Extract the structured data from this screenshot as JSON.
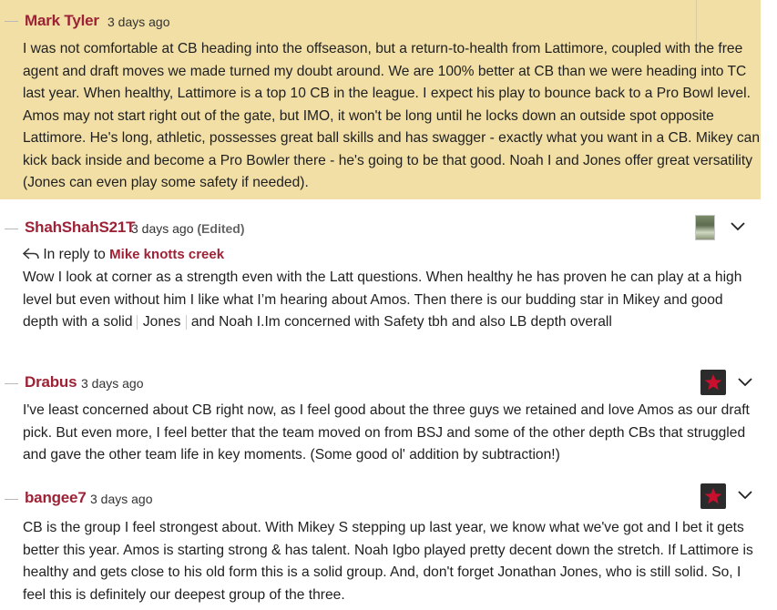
{
  "comments": [
    {
      "author": "Mark Tyler",
      "time": "3 days ago",
      "body": "I was not comfortable at CB heading into the offseason, but a return-to-health from Lattimore, coupled with the free agent and draft moves we made turned my doubt around. We are 100% better at CB than we were heading into TC last year. When healthy, Lattimore is a top 10 CB in the league. I expect his play to bounce back to a Pro Bowl level. Amos may not start right out of the gate, but IMO, it won't be long until he locks down an outside spot opposite Lattimore. He's long, athletic, possesses great ball skills and has swagger - exactly what you want in a CB. Mikey can kick back inside and become a Pro Bowler there - he's going to be that good. Noah I and Jones offer great versatility (Jones can even play some safety if needed)."
    },
    {
      "author": "ShahShahS21T",
      "time": "3 days ago",
      "edited": "(Edited)",
      "reply_prefix": "In reply to",
      "reply_to": "Mike knotts creek",
      "body_before": "Wow I look at corner as a strength even with the Latt questions. When healthy he has proven he can play at a high level but even without him I like what I’m hearing about Amos. Then there is our budding star in Mikey and good depth with a solid",
      "body_mention": "Jones",
      "body_after": "and Noah I.Im concerned with Safety tbh and also LB depth overall"
    },
    {
      "author": "Drabus",
      "time": "3 days ago",
      "body": "I've least concerned about CB right now, as I feel good about the three guys we retained and love Amos as our draft pick. But even more, I feel better that the team moved on from BSJ and some of the other depth CBs that struggled and gave the other team life in key moments. (Some good ol' addition by subtraction!)"
    },
    {
      "author": "bangee7",
      "time": "3 days ago",
      "body": "CB is the group I feel strongest about. With Mikey S stepping up last year, we know what we've got and I bet it gets better this year. Amos is starting strong & has talent. Noah Igbo played pretty decent down the stretch. If Lattimore is healthy and gets close to his old form this is a solid group. And, don't forget Jonathan Jones, who is still solid. So, I feel this is definitely our deepest group of the three."
    }
  ],
  "colors": {
    "highlight_bg": "#f1dfa6",
    "username": "#9d2236",
    "badge_star": "#c8102e"
  },
  "icons": {
    "reply": "reply-arrow-icon",
    "menu": "chevron-down-icon",
    "badge": "star-badge-icon"
  }
}
